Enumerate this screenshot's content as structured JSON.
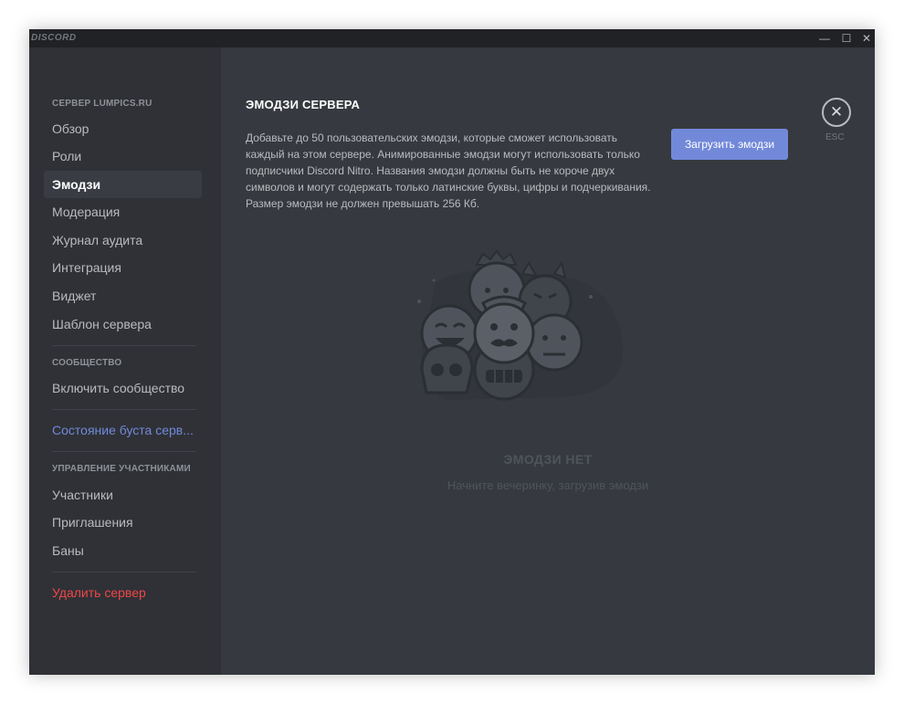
{
  "window": {
    "brand": "DISCORD",
    "controls": {
      "minimize": "—",
      "maximize": "☐",
      "close": "✕"
    }
  },
  "sidebar": {
    "server_header": "СЕРВЕР LUMPICS.RU",
    "server_items": [
      "Обзор",
      "Роли",
      "Эмодзи",
      "Модерация",
      "Журнал аудита",
      "Интеграция",
      "Виджет",
      "Шаблон сервера"
    ],
    "active_item": "Эмодзи",
    "community_header": "СООБЩЕСТВО",
    "community_items": [
      "Включить сообщество"
    ],
    "boost_link": "Состояние буста серв...",
    "members_header": "УПРАВЛЕНИЕ УЧАСТНИКАМИ",
    "members_items": [
      "Участники",
      "Приглашения",
      "Баны"
    ],
    "delete_server": "Удалить сервер"
  },
  "main": {
    "title": "ЭМОДЗИ СЕРВЕРА",
    "description": "Добавьте до 50 пользовательских эмодзи, которые сможет использовать каждый на этом сервере. Анимированные эмодзи могут использовать только подписчики Discord Nitro. Названия эмодзи должны быть не короче двух символов и могут содержать только латинские буквы, цифры и подчеркивания. Размер эмодзи не должен превышать 256 Кб.",
    "upload_button": "Загрузить эмодзи",
    "close_label": "ESC",
    "empty_title": "ЭМОДЗИ НЕТ",
    "empty_subtitle": "Начните вечеринку, загрузив эмодзи"
  },
  "colors": {
    "background": "#36393f",
    "sidebar": "#2f3136",
    "titlebar": "#202225",
    "accent": "#7289da",
    "danger": "#f04747"
  }
}
